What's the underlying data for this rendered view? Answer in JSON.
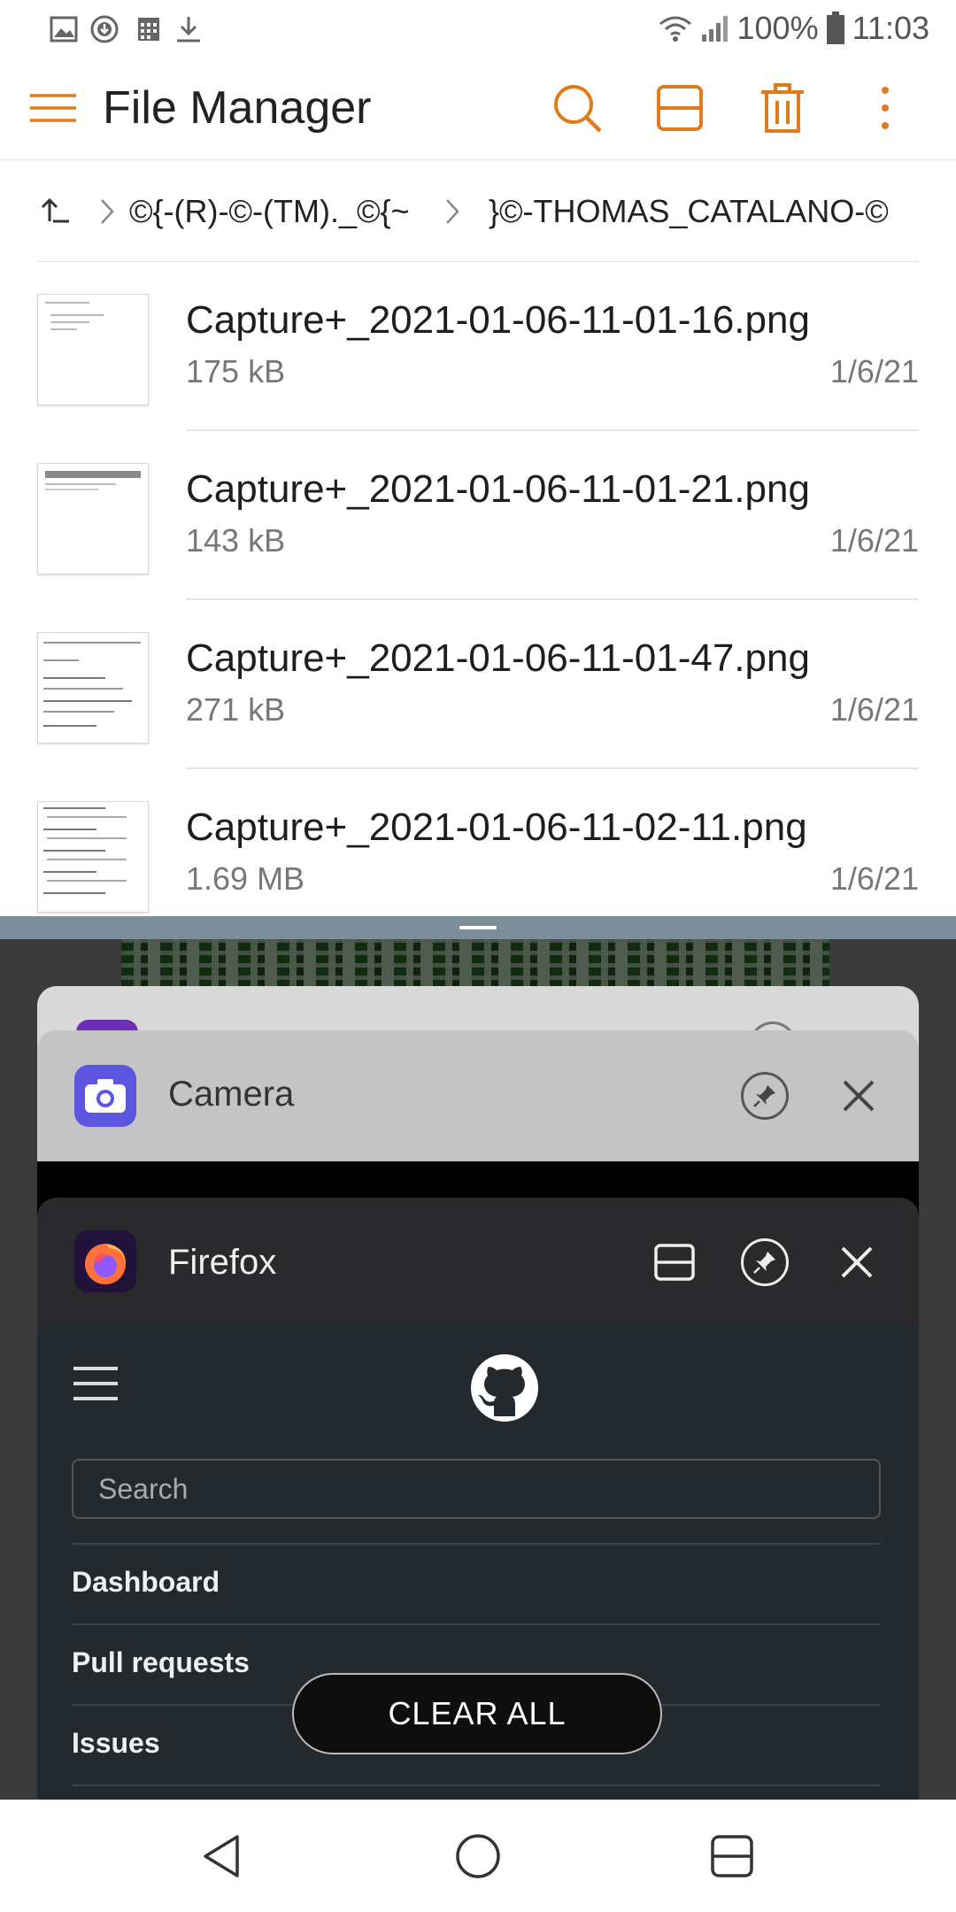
{
  "status_bar": {
    "battery": "100%",
    "time": "11:03",
    "left_icons": [
      "image-icon",
      "download-circle-icon",
      "calendar-icon",
      "download-icon"
    ],
    "right_icons": [
      "wifi-icon",
      "signal-icon",
      "battery-icon"
    ]
  },
  "app_bar": {
    "title": "File Manager",
    "accent": "#e07b1c",
    "actions": [
      "search-icon",
      "split-view-icon",
      "trash-icon",
      "more-vert-icon"
    ]
  },
  "breadcrumb": {
    "items": [
      "©{-(R)-©-(TM)._©{~",
      "}©-THOMAS_CATALANO-©"
    ]
  },
  "files": [
    {
      "name": "Capture+_2021-01-06-11-01-16.png",
      "size": "175 kB",
      "date": "1/6/21"
    },
    {
      "name": "Capture+_2021-01-06-11-01-21.png",
      "size": "143 kB",
      "date": "1/6/21"
    },
    {
      "name": "Capture+_2021-01-06-11-01-47.png",
      "size": "271 kB",
      "date": "1/6/21"
    },
    {
      "name": "Capture+_2021-01-06-11-02-11.png",
      "size": "1.69 MB",
      "date": "1/6/21"
    }
  ],
  "recents": {
    "camera": {
      "title": "Camera"
    },
    "firefox": {
      "title": "Firefox",
      "web": {
        "search_placeholder": "Search",
        "nav_items": [
          "Dashboard",
          "Pull requests",
          "Issues"
        ]
      }
    },
    "clear_all": "CLEAR ALL"
  },
  "nav_bar": [
    "back-icon",
    "home-icon",
    "recents-icon"
  ]
}
